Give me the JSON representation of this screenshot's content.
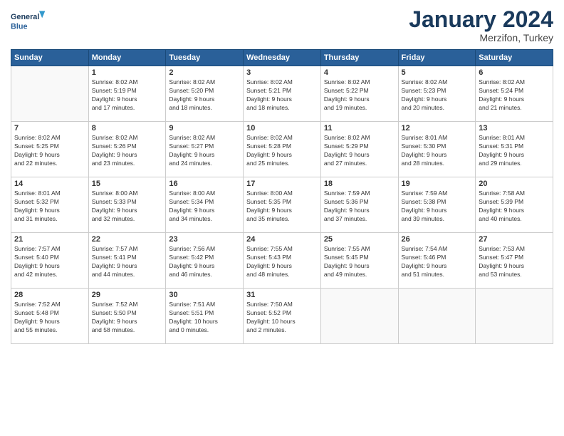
{
  "header": {
    "logo_line1": "General",
    "logo_line2": "Blue",
    "month": "January 2024",
    "location": "Merzifon, Turkey"
  },
  "weekdays": [
    "Sunday",
    "Monday",
    "Tuesday",
    "Wednesday",
    "Thursday",
    "Friday",
    "Saturday"
  ],
  "weeks": [
    [
      {
        "day": "",
        "info": ""
      },
      {
        "day": "1",
        "info": "Sunrise: 8:02 AM\nSunset: 5:19 PM\nDaylight: 9 hours\nand 17 minutes."
      },
      {
        "day": "2",
        "info": "Sunrise: 8:02 AM\nSunset: 5:20 PM\nDaylight: 9 hours\nand 18 minutes."
      },
      {
        "day": "3",
        "info": "Sunrise: 8:02 AM\nSunset: 5:21 PM\nDaylight: 9 hours\nand 18 minutes."
      },
      {
        "day": "4",
        "info": "Sunrise: 8:02 AM\nSunset: 5:22 PM\nDaylight: 9 hours\nand 19 minutes."
      },
      {
        "day": "5",
        "info": "Sunrise: 8:02 AM\nSunset: 5:23 PM\nDaylight: 9 hours\nand 20 minutes."
      },
      {
        "day": "6",
        "info": "Sunrise: 8:02 AM\nSunset: 5:24 PM\nDaylight: 9 hours\nand 21 minutes."
      }
    ],
    [
      {
        "day": "7",
        "info": "Sunrise: 8:02 AM\nSunset: 5:25 PM\nDaylight: 9 hours\nand 22 minutes."
      },
      {
        "day": "8",
        "info": "Sunrise: 8:02 AM\nSunset: 5:26 PM\nDaylight: 9 hours\nand 23 minutes."
      },
      {
        "day": "9",
        "info": "Sunrise: 8:02 AM\nSunset: 5:27 PM\nDaylight: 9 hours\nand 24 minutes."
      },
      {
        "day": "10",
        "info": "Sunrise: 8:02 AM\nSunset: 5:28 PM\nDaylight: 9 hours\nand 25 minutes."
      },
      {
        "day": "11",
        "info": "Sunrise: 8:02 AM\nSunset: 5:29 PM\nDaylight: 9 hours\nand 27 minutes."
      },
      {
        "day": "12",
        "info": "Sunrise: 8:01 AM\nSunset: 5:30 PM\nDaylight: 9 hours\nand 28 minutes."
      },
      {
        "day": "13",
        "info": "Sunrise: 8:01 AM\nSunset: 5:31 PM\nDaylight: 9 hours\nand 29 minutes."
      }
    ],
    [
      {
        "day": "14",
        "info": "Sunrise: 8:01 AM\nSunset: 5:32 PM\nDaylight: 9 hours\nand 31 minutes."
      },
      {
        "day": "15",
        "info": "Sunrise: 8:00 AM\nSunset: 5:33 PM\nDaylight: 9 hours\nand 32 minutes."
      },
      {
        "day": "16",
        "info": "Sunrise: 8:00 AM\nSunset: 5:34 PM\nDaylight: 9 hours\nand 34 minutes."
      },
      {
        "day": "17",
        "info": "Sunrise: 8:00 AM\nSunset: 5:35 PM\nDaylight: 9 hours\nand 35 minutes."
      },
      {
        "day": "18",
        "info": "Sunrise: 7:59 AM\nSunset: 5:36 PM\nDaylight: 9 hours\nand 37 minutes."
      },
      {
        "day": "19",
        "info": "Sunrise: 7:59 AM\nSunset: 5:38 PM\nDaylight: 9 hours\nand 39 minutes."
      },
      {
        "day": "20",
        "info": "Sunrise: 7:58 AM\nSunset: 5:39 PM\nDaylight: 9 hours\nand 40 minutes."
      }
    ],
    [
      {
        "day": "21",
        "info": "Sunrise: 7:57 AM\nSunset: 5:40 PM\nDaylight: 9 hours\nand 42 minutes."
      },
      {
        "day": "22",
        "info": "Sunrise: 7:57 AM\nSunset: 5:41 PM\nDaylight: 9 hours\nand 44 minutes."
      },
      {
        "day": "23",
        "info": "Sunrise: 7:56 AM\nSunset: 5:42 PM\nDaylight: 9 hours\nand 46 minutes."
      },
      {
        "day": "24",
        "info": "Sunrise: 7:55 AM\nSunset: 5:43 PM\nDaylight: 9 hours\nand 48 minutes."
      },
      {
        "day": "25",
        "info": "Sunrise: 7:55 AM\nSunset: 5:45 PM\nDaylight: 9 hours\nand 49 minutes."
      },
      {
        "day": "26",
        "info": "Sunrise: 7:54 AM\nSunset: 5:46 PM\nDaylight: 9 hours\nand 51 minutes."
      },
      {
        "day": "27",
        "info": "Sunrise: 7:53 AM\nSunset: 5:47 PM\nDaylight: 9 hours\nand 53 minutes."
      }
    ],
    [
      {
        "day": "28",
        "info": "Sunrise: 7:52 AM\nSunset: 5:48 PM\nDaylight: 9 hours\nand 55 minutes."
      },
      {
        "day": "29",
        "info": "Sunrise: 7:52 AM\nSunset: 5:50 PM\nDaylight: 9 hours\nand 58 minutes."
      },
      {
        "day": "30",
        "info": "Sunrise: 7:51 AM\nSunset: 5:51 PM\nDaylight: 10 hours\nand 0 minutes."
      },
      {
        "day": "31",
        "info": "Sunrise: 7:50 AM\nSunset: 5:52 PM\nDaylight: 10 hours\nand 2 minutes."
      },
      {
        "day": "",
        "info": ""
      },
      {
        "day": "",
        "info": ""
      },
      {
        "day": "",
        "info": ""
      }
    ]
  ]
}
